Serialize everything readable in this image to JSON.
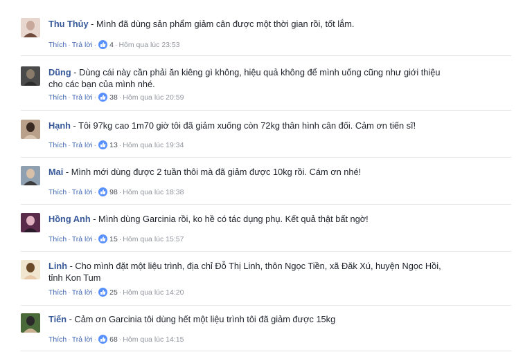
{
  "comments": [
    {
      "name": "Thu Thủy",
      "text": "Mình đã dùng sản phẩm giảm cân được một thời gian rồi, tốt lắm.",
      "like_label": "Thích",
      "reply_label": "Trả lời",
      "likes": "4",
      "time": "Hôm qua lúc 23:53",
      "avatar_colors": [
        "#e8d7cf",
        "#c7a89a",
        "#6f4a3d"
      ]
    },
    {
      "name": "Dũng",
      "text": "Dùng cái này cần phải ăn kiêng gì không, hiệu quả không để mình uống cũng như giới thiệu cho các bạn của mình nhé.",
      "like_label": "Thích",
      "reply_label": "Trả lời",
      "likes": "38",
      "time": "Hôm qua lúc 20:59",
      "avatar_colors": [
        "#4a4a4a",
        "#8a7a6a",
        "#2b2b2b"
      ]
    },
    {
      "name": "Hạnh",
      "text": "Tôi 97kg cao 1m70 giờ tôi đã giảm xuống còn 72kg thân hình cân đối. Cảm ơn tiến sĩ!",
      "like_label": "Thích",
      "reply_label": "Trả lời",
      "likes": "13",
      "time": "Hôm qua lúc 19:34",
      "avatar_colors": [
        "#b9a08a",
        "#3a2a22",
        "#d9c4b0"
      ]
    },
    {
      "name": "Mai",
      "text": "Mình mới dùng được 2 tuần thôi mà đã giảm được 10kg rồi. Cám ơn nhé!",
      "like_label": "Thích",
      "reply_label": "Trả lời",
      "likes": "98",
      "time": "Hôm qua lúc 18:38",
      "avatar_colors": [
        "#8fa0b0",
        "#d8c0a8",
        "#3b3b3b"
      ]
    },
    {
      "name": "Hồng Anh",
      "text": "Mình dùng Garcinia rồi, ko hề có tác dụng phụ. Kết quả thật bất ngờ!",
      "like_label": "Thích",
      "reply_label": "Trả lời",
      "likes": "15",
      "time": "Hôm qua lúc 15:57",
      "avatar_colors": [
        "#5a2a4a",
        "#e0b0c0",
        "#2a1a2a"
      ]
    },
    {
      "name": "Linh",
      "text": "Cho mình đặt một liệu trình, địa chỉ Đỗ Thị Linh, thôn Ngọc Tiền, xã Đăk Xú, huyện Ngọc Hồi, tỉnh Kon Tum",
      "like_label": "Thích",
      "reply_label": "Trả lời",
      "likes": "25",
      "time": "Hôm qua lúc 14:20",
      "avatar_colors": [
        "#f0e6d0",
        "#6b4a2a",
        "#e8c8a8"
      ]
    },
    {
      "name": "Tiến",
      "text": "Cảm ơn Garcinia tôi dùng hết một liệu trình tôi đã giảm được 15kg",
      "like_label": "Thích",
      "reply_label": "Trả lời",
      "likes": "68",
      "time": "Hôm qua lúc 14:15",
      "avatar_colors": [
        "#4a6a3a",
        "#2a2a2a",
        "#c8b090"
      ]
    }
  ],
  "colors": {
    "name": "#365899",
    "link": "#4267b2",
    "like_icon": "#5890ff",
    "divider": "#e5e6e9"
  }
}
